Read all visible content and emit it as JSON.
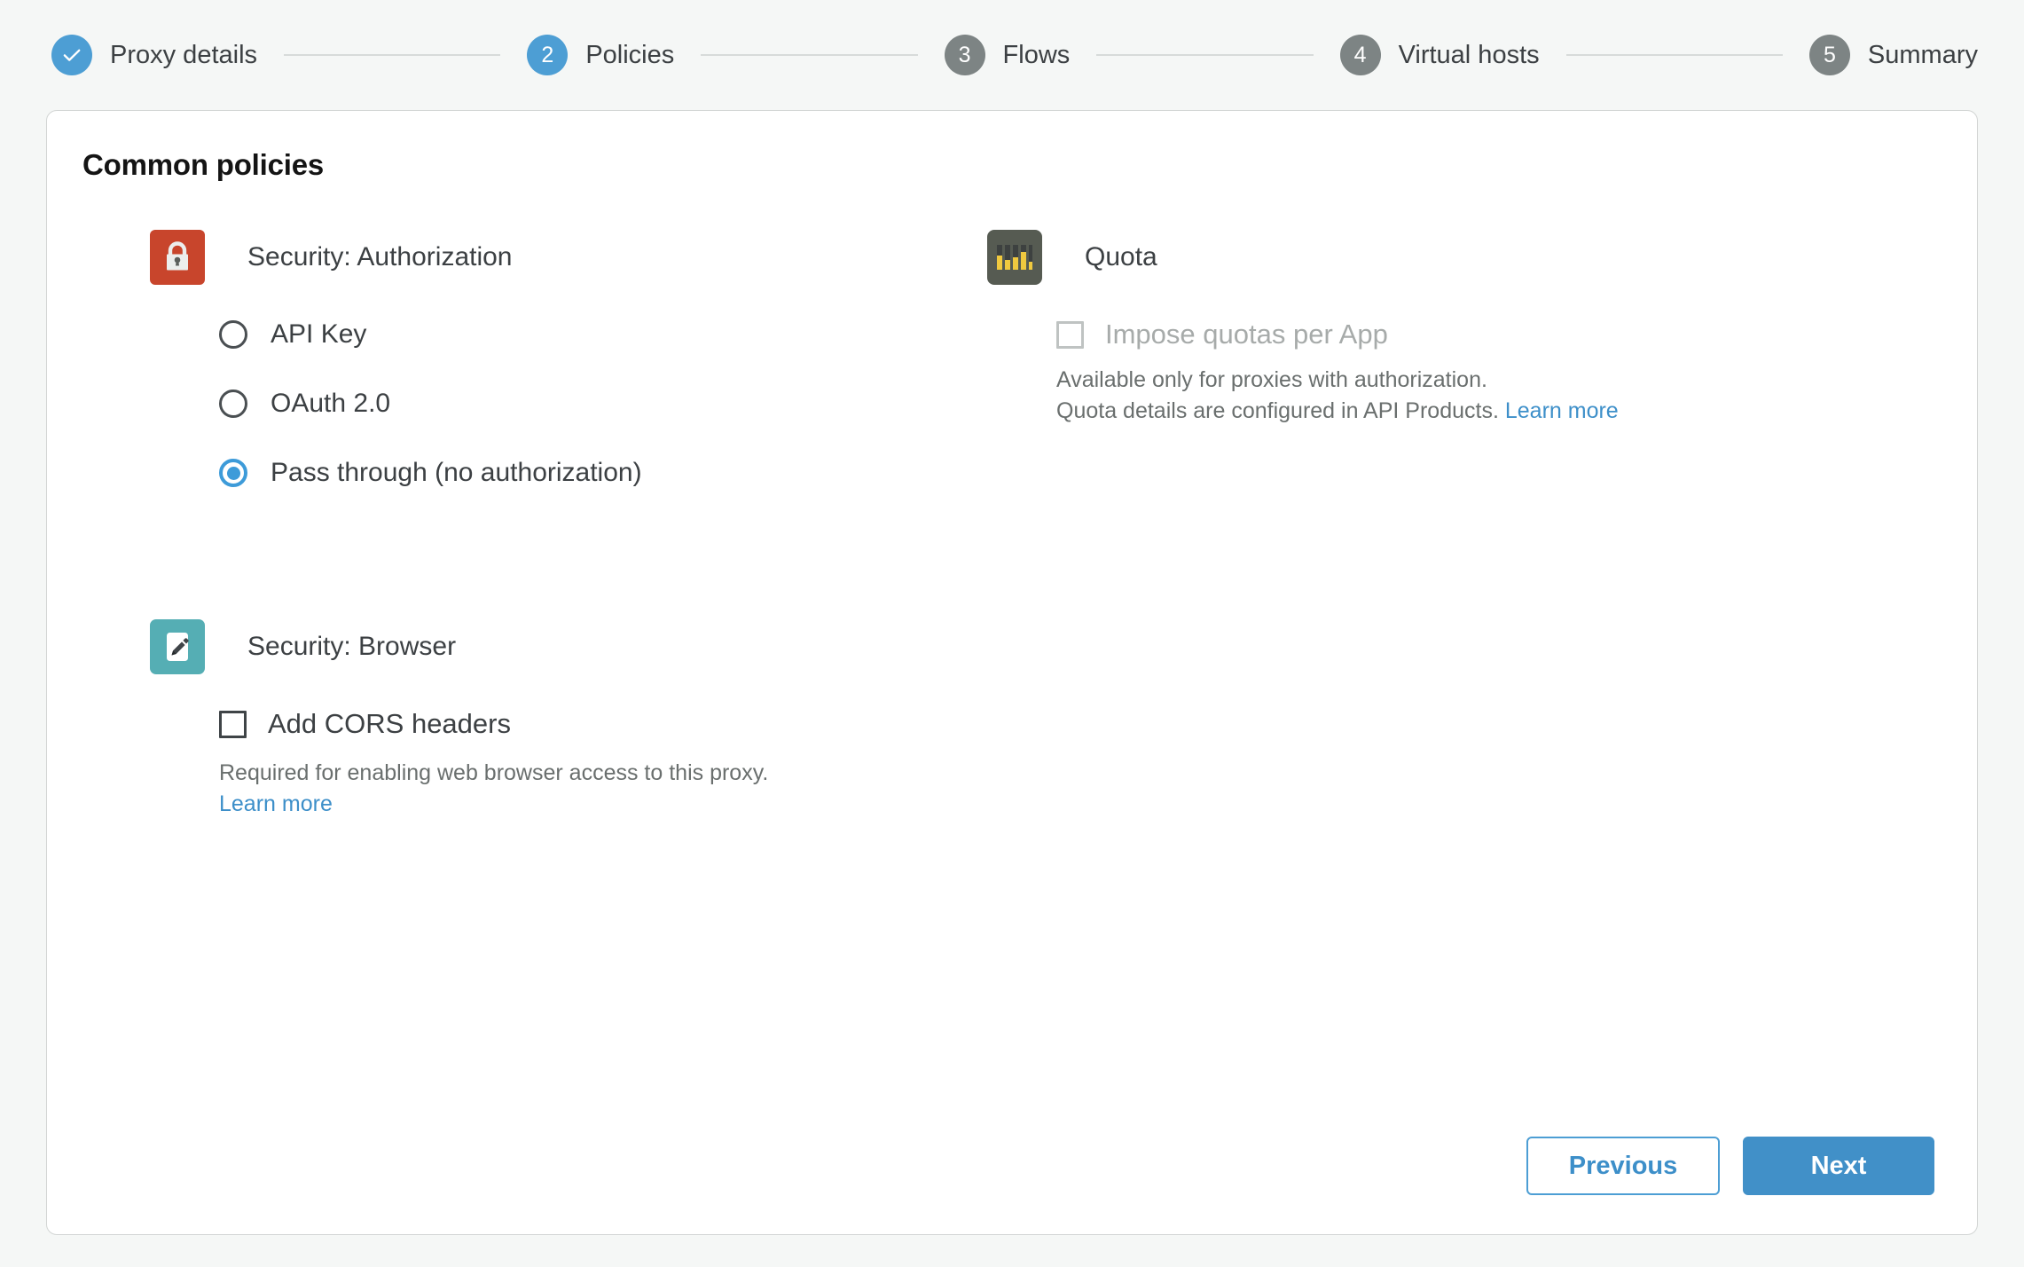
{
  "stepper": {
    "steps": [
      {
        "marker": "check",
        "label": "Proxy details",
        "state": "done"
      },
      {
        "marker": "2",
        "label": "Policies",
        "state": "active"
      },
      {
        "marker": "3",
        "label": "Flows",
        "state": "todo"
      },
      {
        "marker": "4",
        "label": "Virtual hosts",
        "state": "todo"
      },
      {
        "marker": "5",
        "label": "Summary",
        "state": "todo"
      }
    ]
  },
  "card": {
    "title": "Common policies"
  },
  "policies": {
    "authorization": {
      "icon": "lock-icon",
      "name": "Security: Authorization",
      "options": [
        {
          "label": "API Key",
          "selected": false
        },
        {
          "label": "OAuth 2.0",
          "selected": false
        },
        {
          "label": "Pass through (no authorization)",
          "selected": true
        }
      ]
    },
    "browser": {
      "icon": "pencil-icon",
      "name": "Security: Browser",
      "checkbox_label": "Add CORS headers",
      "checked": false,
      "help_line1": "Required for enabling web browser access to this proxy.",
      "learn_more": "Learn more"
    },
    "quota": {
      "icon": "quota-bars-icon",
      "name": "Quota",
      "checkbox_label": "Impose quotas per App",
      "checked": false,
      "disabled": true,
      "help_line1": "Available only for proxies with authorization.",
      "help_line2": "Quota details are configured in API Products.",
      "learn_more": "Learn more"
    }
  },
  "footer": {
    "previous_label": "Previous",
    "next_label": "Next"
  },
  "colors": {
    "accent_blue": "#4d9ed4",
    "link_blue": "#3d8fc9",
    "step_todo_gray": "#7d8484",
    "lock_red": "#c8452c",
    "pencil_teal": "#55aeb4",
    "quota_dark": "#565b52",
    "quota_yellow": "#f0c93f",
    "page_bg": "#f5f7f6"
  }
}
